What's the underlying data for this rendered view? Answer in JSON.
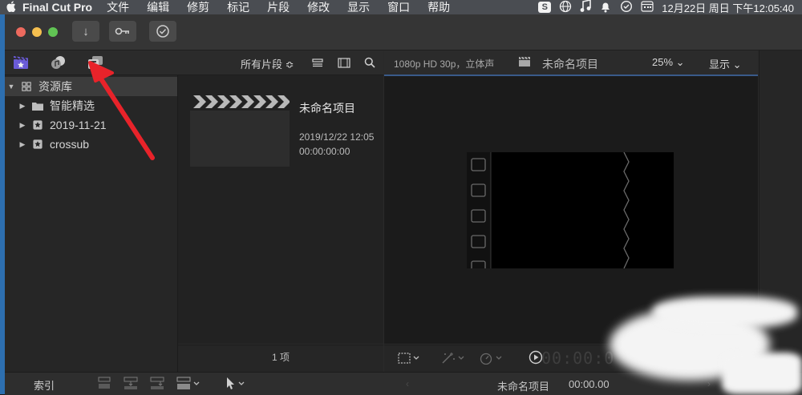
{
  "menubar": {
    "apple": "",
    "app_name": "Final Cut Pro",
    "items": [
      "文件",
      "编辑",
      "修剪",
      "标记",
      "片段",
      "修改",
      "显示",
      "窗口",
      "帮助"
    ],
    "clock": "12月22日 周日 下午12:05:40",
    "status_icons": [
      "sogou-icon",
      "globe-icon",
      "music-icon",
      "notification-icon",
      "sync-icon",
      "calendar-icon"
    ]
  },
  "toolbar": {
    "import_icon": "↓",
    "keyword_icon": "⊸",
    "check_icon": "✓"
  },
  "browser_toolbar": {
    "filter_label": "所有片段 ≎"
  },
  "library": {
    "root_label": "资源库",
    "items": [
      {
        "label": "智能精选",
        "icon": "folder-icon"
      },
      {
        "label": "2019-11-21",
        "icon": "event-icon"
      },
      {
        "label": "crossub",
        "icon": "event-icon"
      }
    ]
  },
  "browser": {
    "project": {
      "title": "未命名项目",
      "date": "2019/12/22 12:05",
      "duration": "00:00:00:00"
    },
    "footer_count": "1 项"
  },
  "viewer": {
    "format": "1080p HD 30p，立体声",
    "project_name": "未命名项目",
    "zoom": "25% ⌄",
    "display_menu": "显示 ⌄",
    "timecode": "00:00:0"
  },
  "bottom": {
    "index_label": "索引",
    "project_name": "未命名项目",
    "timecode": "00:00.00"
  },
  "colors": {
    "accent": "#3a5a8a",
    "close": "#ed6a5e",
    "minimize": "#f5bf4f",
    "zoom": "#61c454",
    "annotation_arrow": "#e8232a"
  }
}
